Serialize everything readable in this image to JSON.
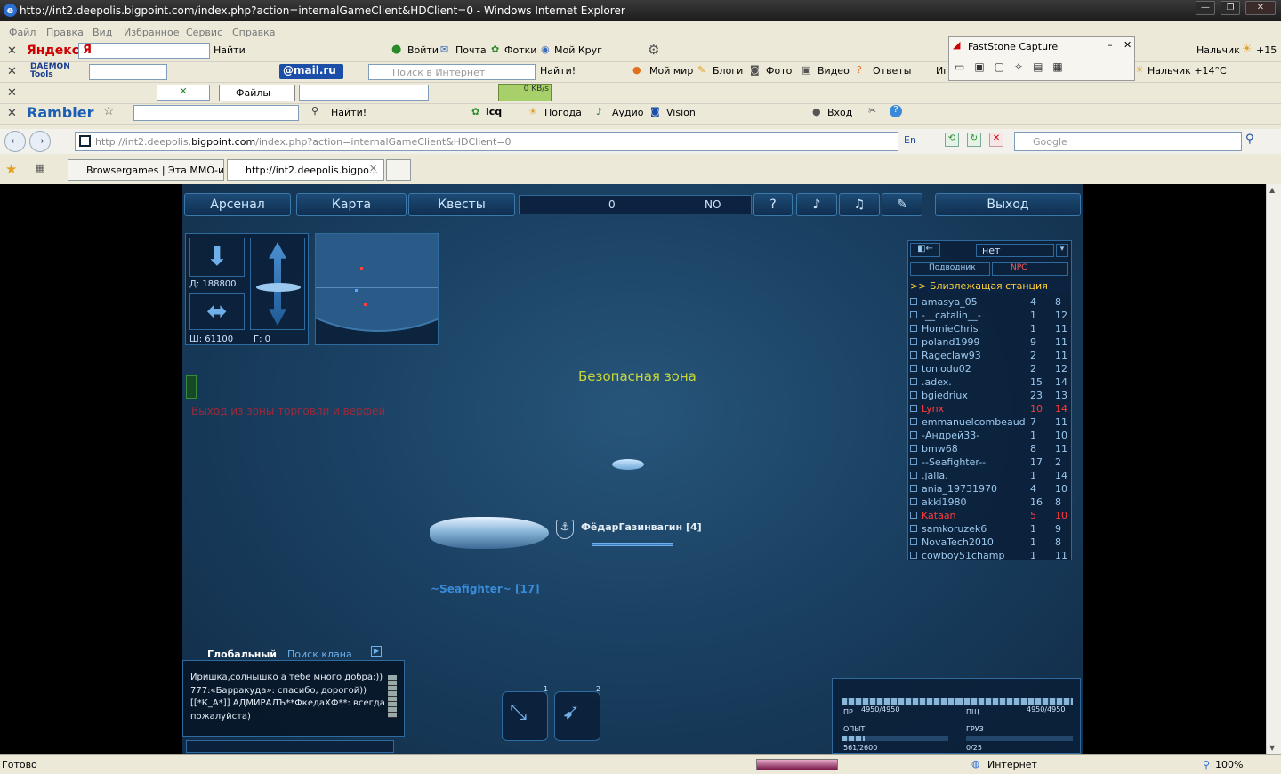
{
  "window": {
    "title": "http://int2.deepolis.bigpoint.com/index.php?action=internalGameClient&HDClient=0 - Windows Internet Explorer"
  },
  "menu": [
    "Файл",
    "Правка",
    "Вид",
    "Избранное",
    "Сервис",
    "Справка"
  ],
  "yandex_bar": {
    "brand": "Яндекс",
    "field": "Я",
    "find": "Найти",
    "login": "Войти",
    "mail": "Почта",
    "photos": "Фотки",
    "circle": "Мой Круг",
    "city": "Нальчик",
    "temp": "+15"
  },
  "faststone": {
    "title": "FastStone Capture"
  },
  "mailru_bar": {
    "brand": "DAEMON Tools",
    "mail": "@mail.ru",
    "placeholder": "Поиск в Интернет",
    "find": "Найти!",
    "myworld": "Мой мир",
    "blogs": "Блоги",
    "photo": "Фото",
    "video": "Видео",
    "answers": "Ответы",
    "more": "Иг",
    "weather": "Нальчик +14°C"
  },
  "third_bar": {
    "files": "Файлы",
    "speed": "0 KB/s"
  },
  "rambler_bar": {
    "brand": "Rambler",
    "find": "Найти!",
    "icq": "icq",
    "weather": "Погода",
    "audio": "Аудио",
    "vision": "Vision",
    "login": "Вход"
  },
  "nav": {
    "url_grey": "http://int2.deepolis.",
    "url_bold": "bigpoint.com",
    "url_rest": "/index.php?action=internalGameClient&HDClient=0",
    "lang": "En",
    "search_placeholder": "Google"
  },
  "tabs": [
    {
      "label": "Browsergames | Эта ММО-и..."
    },
    {
      "label": "http://int2.deepolis.bigpo..."
    }
  ],
  "status": {
    "text": "Готово",
    "zone": "Интернет",
    "zoom": "100%"
  },
  "game": {
    "menu": {
      "arsenal": "Арсенал",
      "map": "Карта",
      "quests": "Квесты",
      "counter": "0",
      "compass": "NO",
      "help": "?",
      "exit": "Выход"
    },
    "depth": {
      "depth": "Д: 188800",
      "width": "Ш: 61100",
      "angle": "Г: 0"
    },
    "zone": "Безопасная зона",
    "zone_warn": "Выход из зоны торговли и верфей",
    "ship_name": "ФёдарГазинвагин [4]",
    "other_name": "~Seafighter~ [17]",
    "userlist": {
      "filter": "нет",
      "tab_subs": "Подводник",
      "tab_npc": "NPC",
      "header": ">> Близлежащая станция",
      "rows": [
        {
          "name": "amasya_05",
          "a": "4",
          "b": "8",
          "red": false
        },
        {
          "name": "-__catalin__-",
          "a": "1",
          "b": "12",
          "red": false
        },
        {
          "name": "HomieChris",
          "a": "1",
          "b": "11",
          "red": false
        },
        {
          "name": "poland1999",
          "a": "9",
          "b": "11",
          "red": false
        },
        {
          "name": "Rageclaw93",
          "a": "2",
          "b": "11",
          "red": false
        },
        {
          "name": "toniodu02",
          "a": "2",
          "b": "12",
          "red": false
        },
        {
          "name": ".adex.",
          "a": "15",
          "b": "14",
          "red": false
        },
        {
          "name": "bgiedriux",
          "a": "23",
          "b": "13",
          "red": false
        },
        {
          "name": "Lynx",
          "a": "10",
          "b": "14",
          "red": true
        },
        {
          "name": "emmanuelcombeaud",
          "a": "7",
          "b": "11",
          "red": false
        },
        {
          "name": "-Андрей33-",
          "a": "1",
          "b": "10",
          "red": false
        },
        {
          "name": "bmw68",
          "a": "8",
          "b": "11",
          "red": false
        },
        {
          "name": "--Seafighter--",
          "a": "17",
          "b": "2",
          "red": false
        },
        {
          "name": ".jalla.",
          "a": "1",
          "b": "14",
          "red": false
        },
        {
          "name": "ania_19731970",
          "a": "4",
          "b": "10",
          "red": false
        },
        {
          "name": "akki1980",
          "a": "16",
          "b": "8",
          "red": false
        },
        {
          "name": "Kataan",
          "a": "5",
          "b": "10",
          "red": true
        },
        {
          "name": "samkoruzek6",
          "a": "1",
          "b": "9",
          "red": false
        },
        {
          "name": "NovaTech2010",
          "a": "1",
          "b": "8",
          "red": false
        },
        {
          "name": "cowboy51champ",
          "a": "1",
          "b": "11",
          "red": false
        }
      ]
    },
    "chat": {
      "tab_global": "Глобальный",
      "tab_clan": "Поиск клана",
      "lines": [
        "Иришка,солнышко а тебе много добра:))",
        "777:«Барракуда»: спасибо, дорогой))",
        "[[*К_А*]] АДМИРАЛЪ**ФкедаХФ**: всегда",
        "пожалуйста)"
      ]
    },
    "slots": {
      "s1": "1",
      "s2": "2"
    },
    "stats": {
      "hp_label": "ПР",
      "hp": "4950/4950",
      "shield_label": "ПЩ",
      "shield": "4950/4950",
      "xp_label": "ОПЫТ",
      "xp": "561/2600",
      "cargo_label": "ГРУЗ",
      "cargo": "0/25",
      "hp_fill": 1.0,
      "shield_fill": 1.0,
      "xp_fill": 0.22,
      "cargo_fill": 0.0
    }
  }
}
